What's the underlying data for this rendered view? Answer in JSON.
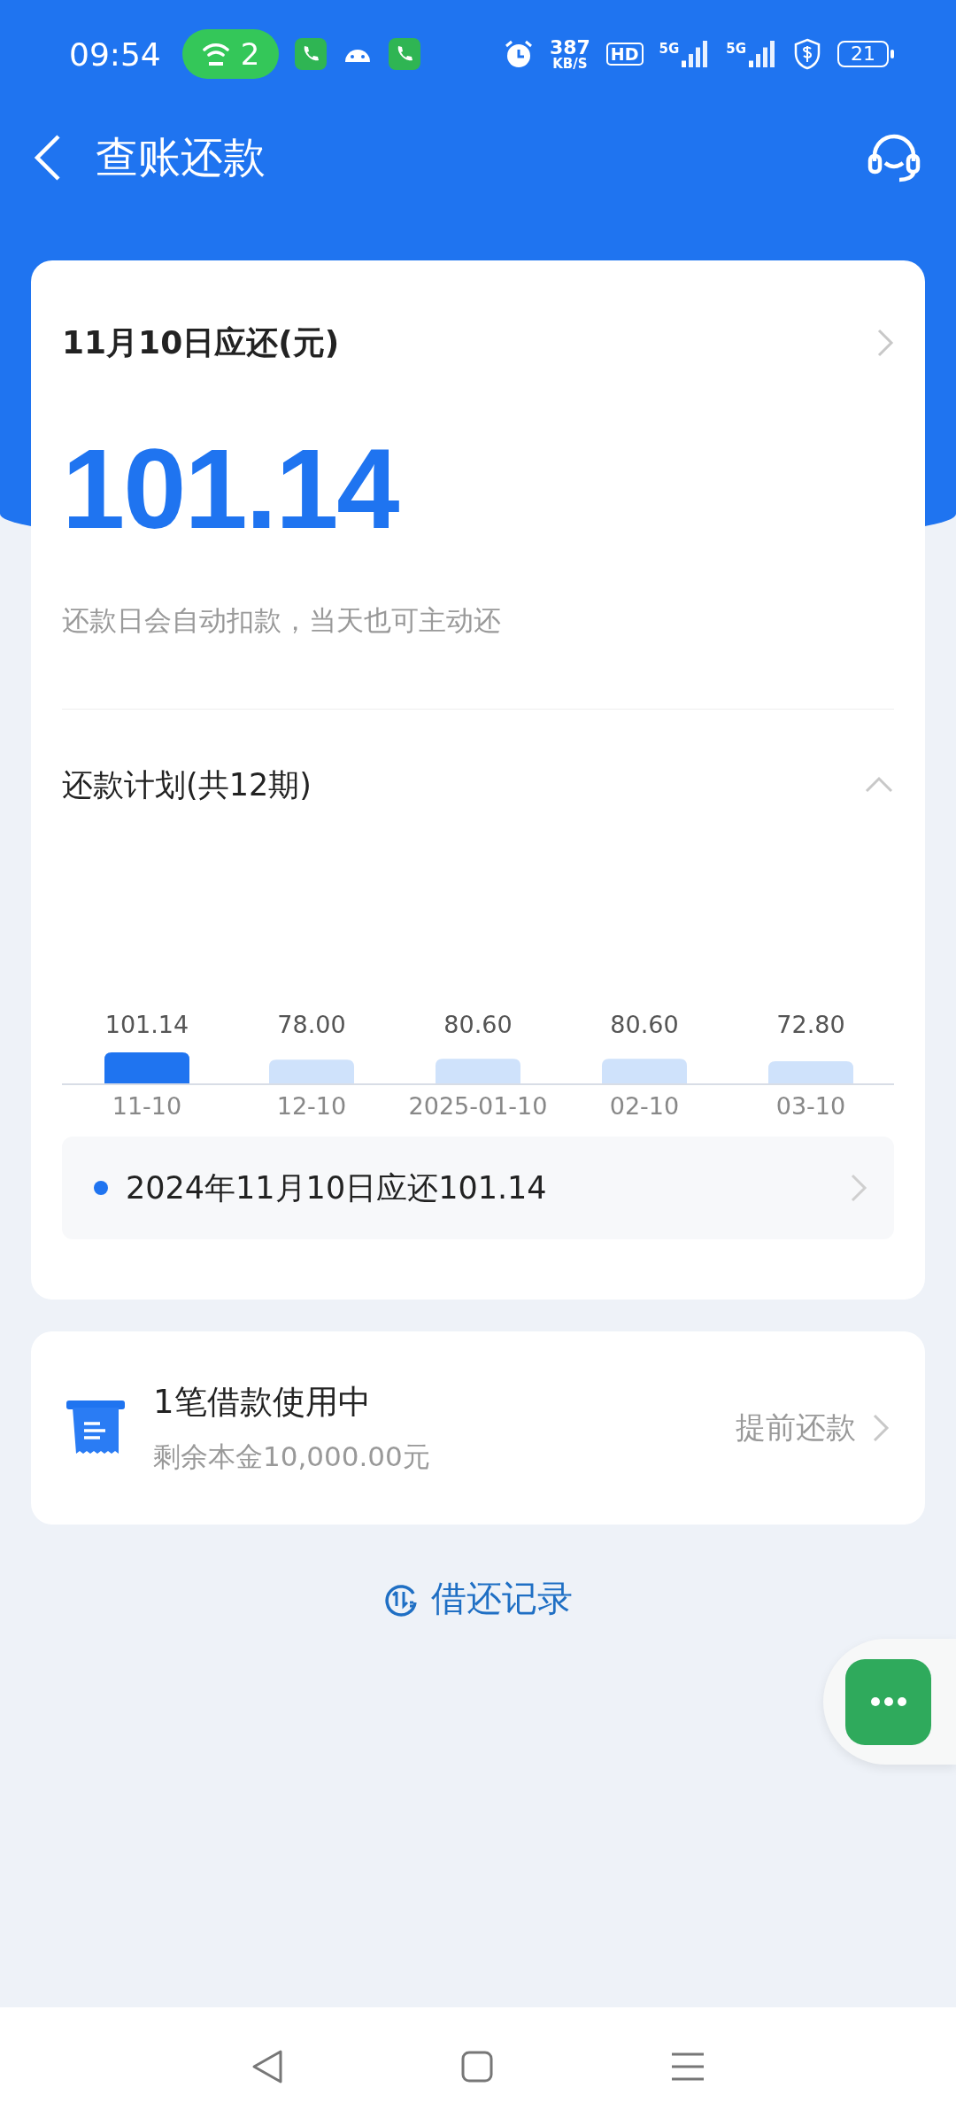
{
  "status_bar": {
    "time": "09:54",
    "hotspot_count": "2",
    "speed_value": "387",
    "speed_unit": "KB/S",
    "hd_label": "HD",
    "network_labels": [
      "5G",
      "5G"
    ],
    "battery": "21"
  },
  "header": {
    "title": "查账还款"
  },
  "due_card": {
    "title": "11月10日应还(元)",
    "amount": "101.14",
    "note": "还款日会自动扣款，当天也可主动还"
  },
  "schedule": {
    "title": "还款计划(共12期)",
    "expanded": true,
    "chart_data": {
      "type": "bar",
      "categories": [
        "11-10",
        "12-10",
        "2025-01-10",
        "02-10",
        "03-10"
      ],
      "values": [
        101.14,
        78.0,
        80.6,
        80.6,
        72.8
      ],
      "data_labels": true,
      "value_labels": [
        "101.14",
        "78.00",
        "80.60",
        "80.60",
        "72.80"
      ]
    },
    "bars": [
      {
        "selected": true
      },
      {
        "selected": false
      },
      {
        "selected": false
      },
      {
        "selected": false
      },
      {
        "selected": false
      }
    ],
    "detail": "2024年11月10日应还101.14"
  },
  "loan_card": {
    "title": "1笔借款使用中",
    "subtitle": "剩余本金10,000.00元",
    "action": "提前还款"
  },
  "records_link": "借还记录"
}
